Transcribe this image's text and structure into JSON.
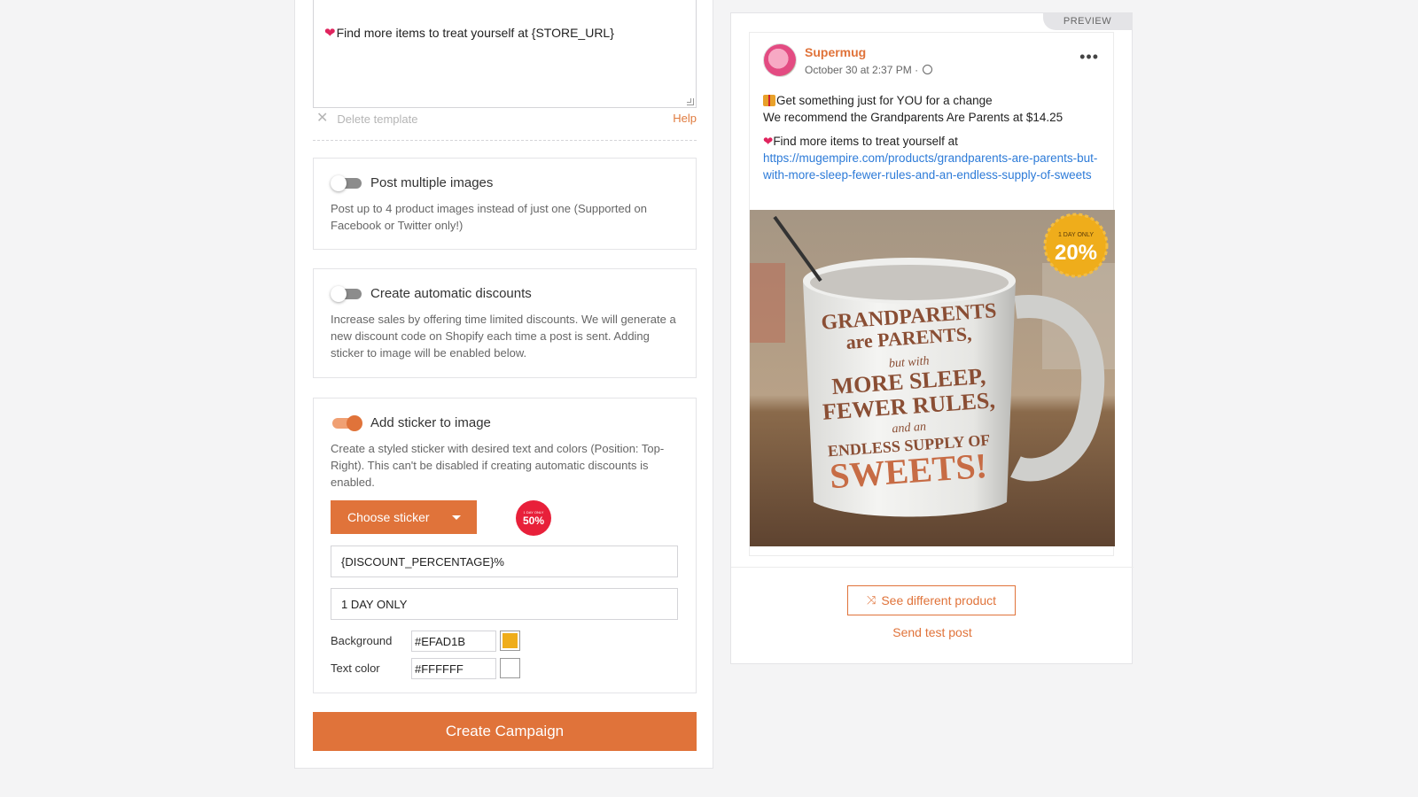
{
  "editor": {
    "template_text": "Find more items to treat yourself at {STORE_URL}",
    "delete_template_label": "Delete template",
    "help_label": "Help"
  },
  "options": {
    "multiple_images": {
      "title": "Post multiple images",
      "description": "Post up to 4 product images instead of just one (Supported on Facebook or Twitter only!)",
      "enabled": false
    },
    "auto_discounts": {
      "title": "Create automatic discounts",
      "description": "Increase sales by offering time limited discounts. We will generate a new discount code on Shopify each time a post is sent. Adding sticker to image will be enabled below.",
      "enabled": false
    },
    "sticker": {
      "title": "Add sticker to image",
      "description": "Create a styled sticker with desired text and colors (Position: Top-Right). This can't be disabled if creating automatic discounts is enabled.",
      "enabled": true,
      "choose_label": "Choose sticker",
      "preview_top": "1 DAY ONLY",
      "preview_value": "50%",
      "text_value": "{DISCOUNT_PERCENTAGE}%",
      "subtext_value": "1 DAY ONLY",
      "background_label": "Background",
      "background_value": "#EFAD1B",
      "text_color_label": "Text color",
      "text_color_value": "#FFFFFF"
    }
  },
  "create_button_label": "Create Campaign",
  "preview": {
    "tag": "PREVIEW",
    "author": "Supermug",
    "date": "October 30 at 2:37 PM ·",
    "line1": "Get something just for YOU for a change",
    "line2": "We recommend the Grandparents Are Parents at $14.25",
    "line3": "Find more items to treat yourself at",
    "link": "https://mugempire.com/products/grandparents-are-parents-but-with-more-sleep-fewer-rules-and-an-endless-supply-of-sweets",
    "sticker_top": "1 DAY ONLY",
    "sticker_value": "20%",
    "mug_text": [
      "GRANDPARENTS",
      "are",
      "PARENTS,",
      "but with",
      "MORE SLEEP,",
      "FEWER RULES,",
      "and an",
      "ENDLESS SUPPLY OF",
      "SWEETS!"
    ],
    "see_different_label": "See different product",
    "send_test_label": "Send test post"
  },
  "colors": {
    "accent": "#e0733a",
    "sticker_background": "#EFAD1B",
    "sticker_text": "#FFFFFF"
  },
  "icons": {
    "delete": "close-icon",
    "caret": "chevron-down-icon",
    "shuffle": "shuffle-icon",
    "more": "more-horizontal-icon",
    "globe": "globe-icon"
  }
}
